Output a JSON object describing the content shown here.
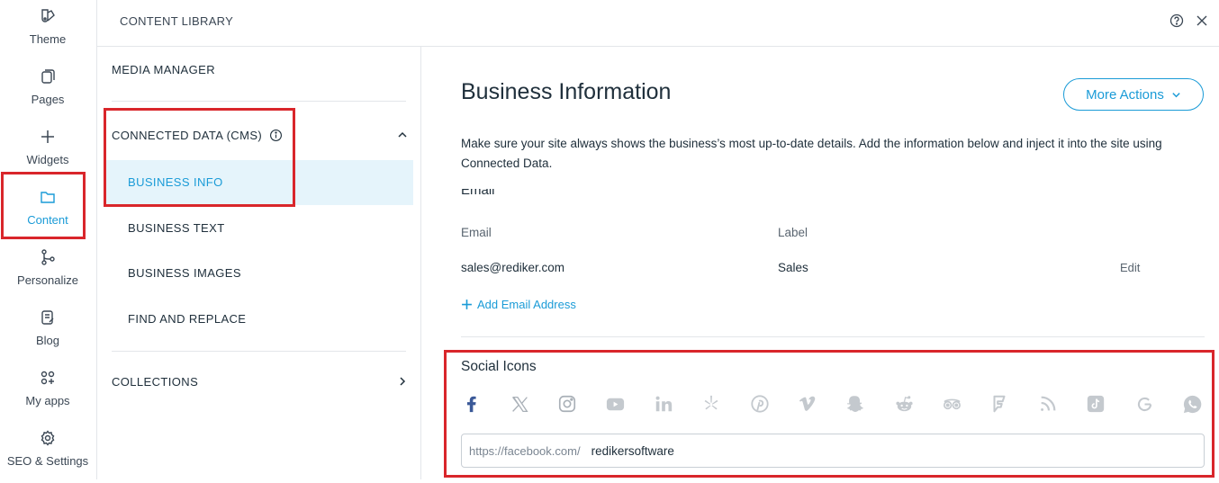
{
  "rail": {
    "items": [
      {
        "label": "Theme",
        "icon": "palette-icon"
      },
      {
        "label": "Pages",
        "icon": "pages-icon"
      },
      {
        "label": "Widgets",
        "icon": "plus-icon"
      },
      {
        "label": "Content",
        "icon": "folder-icon",
        "active": true
      },
      {
        "label": "Personalize",
        "icon": "branch-icon"
      },
      {
        "label": "Blog",
        "icon": "blog-icon"
      },
      {
        "label": "My apps",
        "icon": "apps-icon"
      },
      {
        "label": "SEO & Settings",
        "icon": "gear-icon"
      }
    ]
  },
  "header": {
    "title": "CONTENT LIBRARY"
  },
  "menu": {
    "media_manager": "MEDIA MANAGER",
    "connected_data": "CONNECTED DATA (CMS)",
    "sub_items": [
      "BUSINESS INFO",
      "BUSINESS TEXT",
      "BUSINESS IMAGES",
      "FIND AND REPLACE"
    ],
    "collections": "COLLECTIONS"
  },
  "main": {
    "title": "Business Information",
    "more_actions": "More Actions",
    "description": "Make sure your site always shows the business’s most up-to-date details. Add the information below and inject it into the site using Connected Data.",
    "cut_heading": "Email",
    "columns": {
      "email": "Email",
      "label": "Label"
    },
    "row": {
      "email": "sales@rediker.com",
      "label": "Sales",
      "edit": "Edit"
    },
    "add_email": "Add Email Address",
    "social_title": "Social Icons",
    "social_icons": [
      "facebook-icon",
      "x-icon",
      "instagram-icon",
      "youtube-icon",
      "linkedin-icon",
      "yelp-icon",
      "pinterest-icon",
      "vimeo-icon",
      "snapchat-icon",
      "reddit-icon",
      "tripadvisor-icon",
      "foursquare-icon",
      "rss-icon",
      "tiktok-icon",
      "google-icon",
      "whatsapp-icon"
    ],
    "url_prefix": "https://facebook.com/",
    "url_value": "redikersoftware"
  },
  "colors": {
    "accent": "#1a9bd7",
    "highlight": "#d9262b",
    "facebook": "#3b5998",
    "inactive_icon": "#c4c9ce"
  }
}
